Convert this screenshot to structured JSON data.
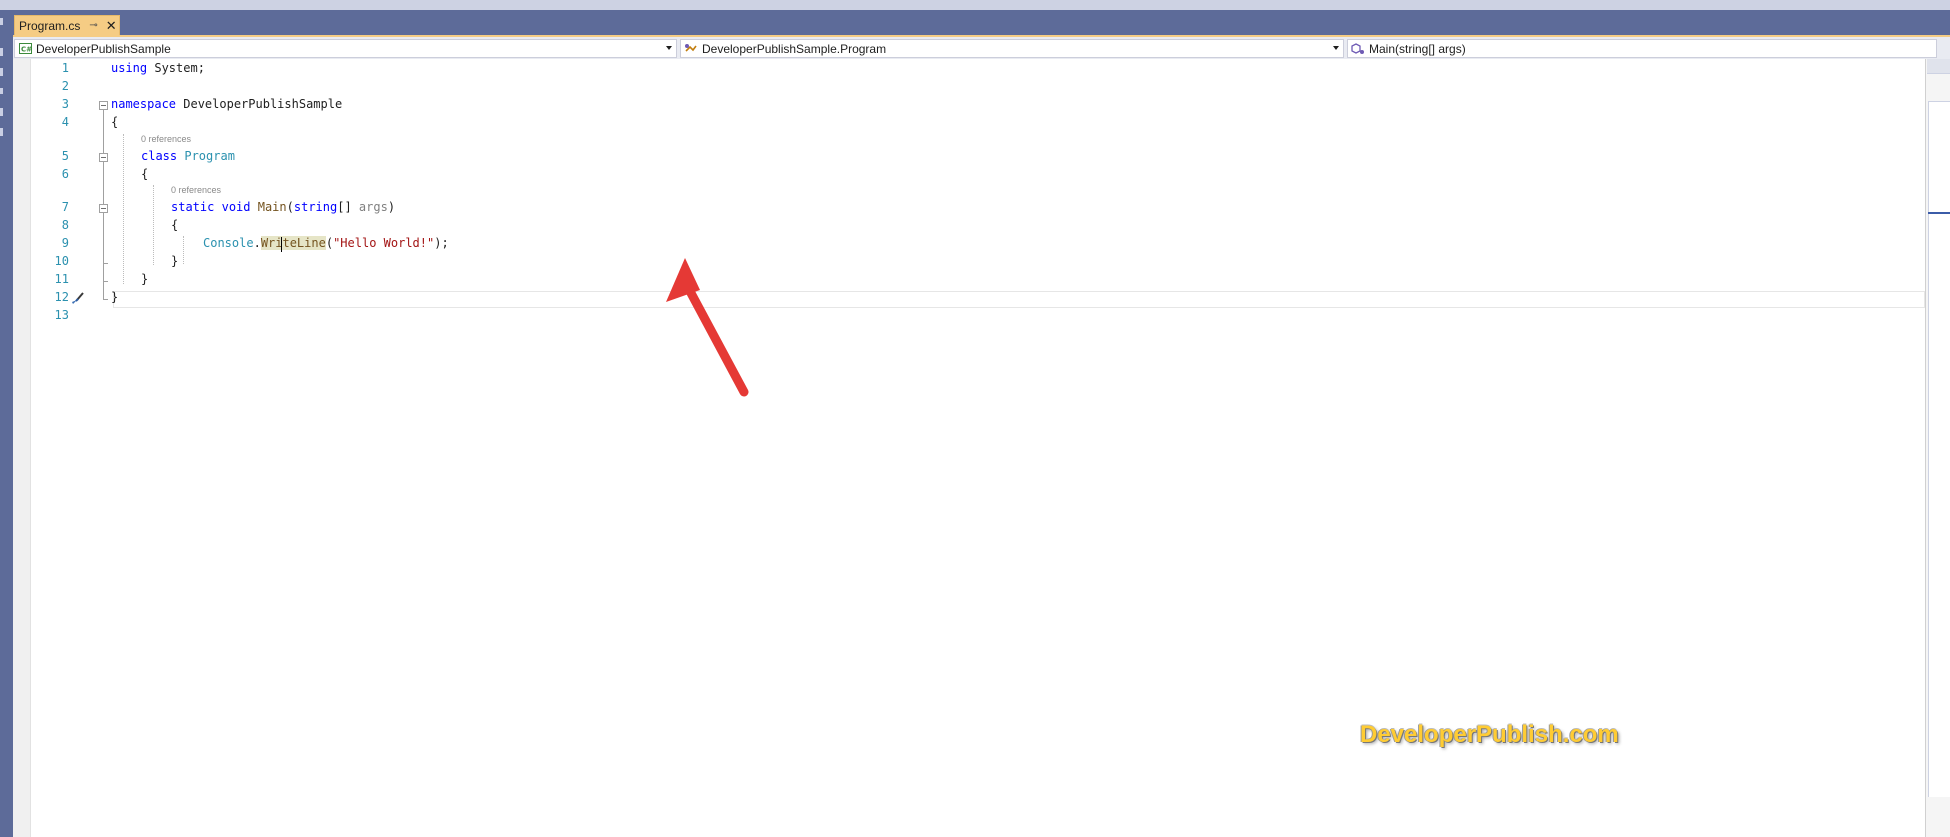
{
  "document_tab": {
    "label": "Program.cs",
    "pin_glyph": "⊸",
    "close_glyph": "✕",
    "color": "#f5cc84"
  },
  "navigation_bar": {
    "project_dropdown": {
      "icon": "csharp-project-icon",
      "value": "DeveloperPublishSample"
    },
    "type_dropdown": {
      "icon": "class-icon",
      "value": "DeveloperPublishSample.Program"
    },
    "member_dropdown": {
      "icon": "method-icon",
      "value": "Main(string[] args)"
    }
  },
  "editor": {
    "line_numbers": [
      "1",
      "2",
      "3",
      "4",
      "5",
      "6",
      "7",
      "8",
      "9",
      "10",
      "11",
      "12",
      "13"
    ],
    "codelens": {
      "class_refs": "0 references",
      "method_refs": "0 references"
    },
    "code": {
      "l1_kw": "using",
      "l1_rest": " System;",
      "l3_kw": "namespace",
      "l3_rest": " DeveloperPublishSample",
      "l4": "{",
      "l5_kw": "class",
      "l5_type": "Program",
      "l6": "{",
      "l7_kw1": "static",
      "l7_kw2": "void",
      "l7_method": "Main",
      "l7_paren": "(",
      "l7_kw3": "string",
      "l7_brackets": "[] ",
      "l7_param": "args",
      "l7_close": ")",
      "l8": "{",
      "l9_type": "Console",
      "l9_dot": ".",
      "l9_method": "WriteLine",
      "l9_paren": "(",
      "l9_string": "\"Hello World!\"",
      "l9_end": ");",
      "l10": "}",
      "l11": "}",
      "l12": "}"
    },
    "colors": {
      "keyword": "#0000ff",
      "type": "#2b91af",
      "method": "#74531f",
      "string": "#a31515",
      "line_number": "#2b91af"
    }
  },
  "watermark": {
    "text": "DeveloperPublish.com",
    "color": "#ffcc33"
  },
  "annotation": {
    "icon": "red-arrow-icon",
    "color": "#e53935"
  }
}
